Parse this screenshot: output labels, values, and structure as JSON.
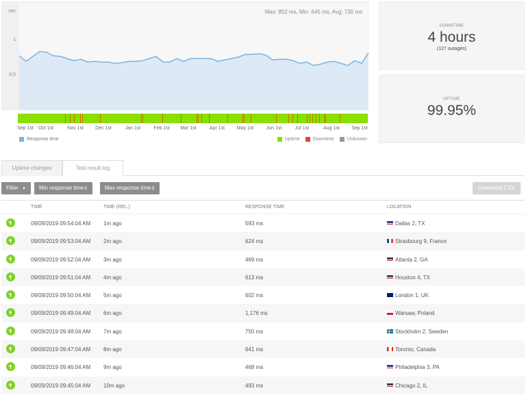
{
  "chart_data": {
    "type": "area",
    "title": "",
    "ylabel": "sec",
    "ylim": [
      0,
      1.0
    ],
    "yticks": [
      {
        "value": 1,
        "label": "1"
      },
      {
        "value": 0.5,
        "label": "0,5"
      }
    ],
    "stats_text": "Max: 852 ms, Min: 645 ms, Avg: 730 ms",
    "x_tick_labels": [
      "Sep 1st",
      "Oct 1st",
      "Nov 1st",
      "Dec 1st",
      "Jan 1st",
      "Feb 1st",
      "Mar 1st",
      "Apr 1st",
      "May 1st",
      "Jun 1st",
      "Jul 1st",
      "Aug 1st",
      "Sep 1st"
    ],
    "series": [
      {
        "name": "Response time",
        "color": "#7ab3e0",
        "fill": "#dde9f5",
        "values": [
          0.79,
          0.71,
          0.78,
          0.85,
          0.84,
          0.79,
          0.78,
          0.75,
          0.72,
          0.74,
          0.7,
          0.71,
          0.7,
          0.7,
          0.68,
          0.69,
          0.71,
          0.71,
          0.72,
          0.75,
          0.78,
          0.7,
          0.7,
          0.75,
          0.71,
          0.75,
          0.75,
          0.75,
          0.75,
          0.71,
          0.73,
          0.75,
          0.77,
          0.81,
          0.81,
          0.82,
          0.8,
          0.73,
          0.74,
          0.74,
          0.72,
          0.68,
          0.7,
          0.65,
          0.67,
          0.7,
          0.71,
          0.68,
          0.65,
          0.72,
          0.68,
          0.83
        ]
      }
    ],
    "status_bar": {
      "base_status": "Uptime",
      "downtime_marks_fraction": [
        0.135,
        0.148,
        0.16,
        0.178,
        0.183,
        0.234,
        0.353,
        0.357,
        0.413,
        0.465,
        0.51,
        0.515,
        0.524,
        0.546,
        0.598,
        0.641,
        0.646,
        0.665,
        0.737,
        0.772,
        0.785,
        0.799,
        0.826,
        0.834,
        0.842,
        0.851,
        0.86,
        0.875,
        0.878,
        0.92
      ]
    },
    "legend": [
      {
        "label": "Response time",
        "color": "#7ab3e0",
        "placement": "bottom-left"
      },
      {
        "label": "Uptime",
        "color": "#8ae000",
        "placement": "bottom-right"
      },
      {
        "label": "Downtime",
        "color": "#e04040",
        "placement": "bottom-right"
      },
      {
        "label": "Unknown",
        "color": "#999999",
        "placement": "bottom-right"
      }
    ]
  },
  "cards": {
    "downtime": {
      "title": "DOWNTIME",
      "value": "4 hours",
      "sub": "(127 outages)"
    },
    "uptime": {
      "title": "UPTIME",
      "value": "99.95%"
    }
  },
  "tabs": [
    {
      "label": "Uptime changes",
      "active": false
    },
    {
      "label": "Test result log",
      "active": true
    }
  ],
  "toolbar": {
    "filter_label": "Filter",
    "min_label": "Min response time",
    "max_label": "Max response time",
    "download_label": "Download CSV"
  },
  "table": {
    "columns": [
      "TIME",
      "TIME (REL.)",
      "RESPONSE TIME",
      "LOCATION"
    ],
    "rows": [
      {
        "status": "up",
        "time": "09/09/2019 09:54:04 AM",
        "rel": "1m ago",
        "response": "593 ms",
        "location": "Dallas 2, TX",
        "flag": "us"
      },
      {
        "status": "up",
        "time": "09/09/2019 09:53:04 AM",
        "rel": "2m ago",
        "response": "624 ms",
        "location": "Strasbourg 9, France",
        "flag": "fr"
      },
      {
        "status": "up",
        "time": "09/09/2019 09:52:04 AM",
        "rel": "3m ago",
        "response": "469 ms",
        "location": "Atlanta 2, GA",
        "flag": "us"
      },
      {
        "status": "up",
        "time": "09/09/2019 09:51:04 AM",
        "rel": "4m ago",
        "response": "613 ms",
        "location": "Houston 4, TX",
        "flag": "us"
      },
      {
        "status": "up",
        "time": "09/09/2019 09:50:04 AM",
        "rel": "5m ago",
        "response": "602 ms",
        "location": "London 1, UK",
        "flag": "uk"
      },
      {
        "status": "up",
        "time": "09/09/2019 09:49:04 AM",
        "rel": "6m ago",
        "response": "1,176 ms",
        "location": "Warsaw, Poland",
        "flag": "pl"
      },
      {
        "status": "up",
        "time": "09/09/2019 09:48:04 AM",
        "rel": "7m ago",
        "response": "750 ms",
        "location": "Stockholm 2, Sweden",
        "flag": "se"
      },
      {
        "status": "up",
        "time": "09/09/2019 09:47:04 AM",
        "rel": "8m ago",
        "response": "641 ms",
        "location": "Toronto, Canada",
        "flag": "ca"
      },
      {
        "status": "up",
        "time": "09/09/2019 09:46:04 AM",
        "rel": "9m ago",
        "response": "468 ms",
        "location": "Philadelphia 3, PA",
        "flag": "us"
      },
      {
        "status": "up",
        "time": "09/09/2019 09:45:04 AM",
        "rel": "10m ago",
        "response": "493 ms",
        "location": "Chicago 2, IL",
        "flag": "us"
      }
    ]
  }
}
